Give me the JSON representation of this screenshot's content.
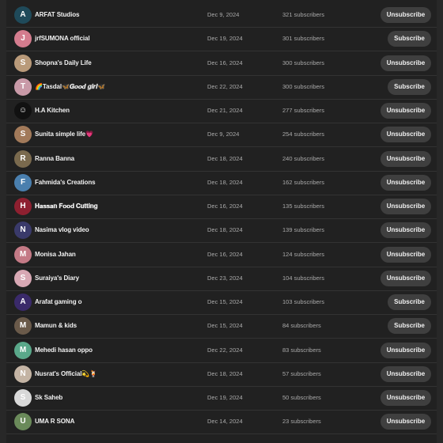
{
  "channels": [
    {
      "name": "ARFAT Studios",
      "date": "Dec 9, 2024",
      "subscribers": "321 subscribers",
      "action": "Unsubscribe",
      "avatar_color": "#1f4a5a",
      "avatar_glyph": "A"
    },
    {
      "name": "jrfSUMONA official",
      "date": "Dec 19, 2024",
      "subscribers": "301 subscribers",
      "action": "Subscribe",
      "avatar_color": "#d47c8e",
      "avatar_glyph": "J"
    },
    {
      "name": "Shopna's Daily Life",
      "date": "Dec 16, 2024",
      "subscribers": "300 subscribers",
      "action": "Unsubscribe",
      "avatar_color": "#b99a7a",
      "avatar_glyph": "S"
    },
    {
      "name": "🌈Tasdal🦋𝑮𝒐𝒐𝒅 𝒈𝒊𝒓𝒍🦋",
      "date": "Dec 22, 2024",
      "subscribers": "300 subscribers",
      "action": "Subscribe",
      "avatar_color": "#c99aa8",
      "avatar_glyph": "T"
    },
    {
      "name": "H.A Kitchen",
      "date": "Dec 21, 2024",
      "subscribers": "277 subscribers",
      "action": "Unsubscribe",
      "avatar_color": "#111111",
      "avatar_glyph": "☺"
    },
    {
      "name": "Sunita simple life💗",
      "date": "Dec 9, 2024",
      "subscribers": "254 subscribers",
      "action": "Unsubscribe",
      "avatar_color": "#a27a5a",
      "avatar_glyph": "S"
    },
    {
      "name": "Ranna Banna",
      "date": "Dec 18, 2024",
      "subscribers": "240 subscribers",
      "action": "Unsubscribe",
      "avatar_color": "#7a6a4e",
      "avatar_glyph": "R"
    },
    {
      "name": "Fahmida's Creations",
      "date": "Dec 18, 2024",
      "subscribers": "162 subscribers",
      "action": "Unsubscribe",
      "avatar_color": "#4a7fae",
      "avatar_glyph": "F"
    },
    {
      "name": "𝐇𝐚𝐬𝐬𝐚𝐧 𝐅𝐨𝐨𝐝 𝐂𝐮𝐭𝐭𝐢𝐧𝐠",
      "date": "Dec 16, 2024",
      "subscribers": "135 subscribers",
      "action": "Unsubscribe",
      "avatar_color": "#8e2030",
      "avatar_glyph": "H"
    },
    {
      "name": "Nasima vlog video",
      "date": "Dec 18, 2024",
      "subscribers": "139 subscribers",
      "action": "Unsubscribe",
      "avatar_color": "#3a3a6a",
      "avatar_glyph": "N"
    },
    {
      "name": "Monisa Jahan",
      "date": "Dec 16, 2024",
      "subscribers": "124 subscribers",
      "action": "Unsubscribe",
      "avatar_color": "#c47a86",
      "avatar_glyph": "M"
    },
    {
      "name": "Suraiya's Diary",
      "date": "Dec 23, 2024",
      "subscribers": "104 subscribers",
      "action": "Unsubscribe",
      "avatar_color": "#d8a8b4",
      "avatar_glyph": "S"
    },
    {
      "name": "Arafat gaming o",
      "date": "Dec 15, 2024",
      "subscribers": "103 subscribers",
      "action": "Subscribe",
      "avatar_color": "#3a2a6a",
      "avatar_glyph": "A"
    },
    {
      "name": "Mamun & kids",
      "date": "Dec 15, 2024",
      "subscribers": "84 subscribers",
      "action": "Subscribe",
      "avatar_color": "#6a5a4a",
      "avatar_glyph": "M"
    },
    {
      "name": "Mehedi hasan oppo",
      "date": "Dec 22, 2024",
      "subscribers": "83 subscribers",
      "action": "Unsubscribe",
      "avatar_color": "#5aa88a",
      "avatar_glyph": "M"
    },
    {
      "name": "Nusrat's Official💫🍹",
      "date": "Dec 18, 2024",
      "subscribers": "57 subscribers",
      "action": "Unsubscribe",
      "avatar_color": "#c4b4a4",
      "avatar_glyph": "N"
    },
    {
      "name": "Sk Saheb",
      "date": "Dec 19, 2024",
      "subscribers": "50 subscribers",
      "action": "Unsubscribe",
      "avatar_color": "#d8d8d8",
      "avatar_glyph": "S"
    },
    {
      "name": "UMA R SONA",
      "date": "Dec 14, 2024",
      "subscribers": "23 subscribers",
      "action": "Unsubscribe",
      "avatar_color": "#6a8a5a",
      "avatar_glyph": "U"
    }
  ]
}
